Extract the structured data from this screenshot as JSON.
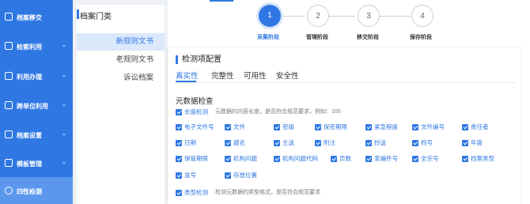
{
  "sidebar": {
    "items": [
      {
        "label": "档案移交",
        "chevron": ""
      },
      {
        "label": "检索利用",
        "chevron": "⌄"
      },
      {
        "label": "利用办理",
        "chevron": "⌄"
      },
      {
        "label": "跨单位利用",
        "chevron": "⌄"
      },
      {
        "label": "档案设置",
        "chevron": "⌄"
      },
      {
        "label": "模板管理",
        "chevron": "⌄"
      },
      {
        "label": "四性检测",
        "chevron": ""
      }
    ]
  },
  "categories": {
    "title": "档案门类",
    "items": [
      "新规则文书",
      "老规则文书",
      "诉讼档案"
    ]
  },
  "steps": [
    {
      "num": "1",
      "label": "采集阶段"
    },
    {
      "num": "2",
      "label": "管理阶段"
    },
    {
      "num": "3",
      "label": "移交阶段"
    },
    {
      "num": "4",
      "label": "保存阶段"
    }
  ],
  "config": {
    "title": "检测项配置",
    "tabs": [
      "真实性",
      "完整性",
      "可用性",
      "安全性"
    ],
    "section_title": "元数据检查",
    "length_check": {
      "label": "长度检测",
      "desc": "元数据的内容长度，是否符合规范要求，例如：100"
    },
    "fields": [
      [
        "电子文件号",
        "文件",
        "密级",
        "保密期限",
        "紧急程度",
        "文件编号",
        "责任者"
      ],
      [
        "日期",
        "题名",
        "主送",
        "附注",
        "抄送",
        "档号",
        "年度"
      ],
      [
        "保管期限",
        "机构问题",
        "机构问题代码",
        "页数",
        "室编件号",
        "全宗号",
        "档案类型"
      ],
      [
        "盒号",
        "存放位置"
      ]
    ],
    "type_check": {
      "label": "类型检测",
      "desc": "检测元数据的类型格式，是否符合规范要求"
    }
  }
}
